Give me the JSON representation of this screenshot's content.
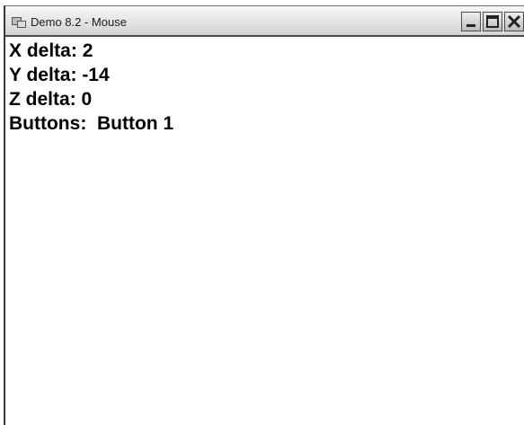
{
  "window": {
    "title": "Demo 8.2 - Mouse"
  },
  "icons": {
    "app": "application-icon",
    "minimize": "minimize-icon",
    "maximize": "maximize-icon",
    "close": "close-icon"
  },
  "readout": {
    "x_label": "X delta:",
    "x_value": "2",
    "y_label": "Y delta:",
    "y_value": "-14",
    "z_label": "Z delta:",
    "z_value": "0",
    "buttons_label": "Buttons:",
    "buttons_value": "Button 1"
  }
}
